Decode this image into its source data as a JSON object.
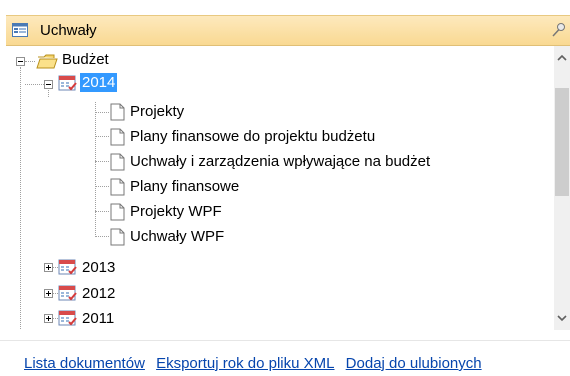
{
  "header": {
    "title": "Uchwały",
    "icon": "window-list-icon",
    "pin_icon": "pin-icon"
  },
  "tree": {
    "root": {
      "label": "Budżet",
      "icon": "folder-icon",
      "expanded": true
    },
    "year_2014": {
      "label": "2014",
      "icon": "calendar-icon",
      "expanded": true,
      "selected": true,
      "children": [
        {
          "label": "Projekty"
        },
        {
          "label": "Plany finansowe do projektu budżetu"
        },
        {
          "label": "Uchwały i zarządzenia wpływające na budżet"
        },
        {
          "label": "Plany finansowe"
        },
        {
          "label": "Projekty WPF"
        },
        {
          "label": "Uchwały WPF"
        }
      ]
    },
    "collapsed_years": [
      {
        "label": "2013"
      },
      {
        "label": "2012"
      },
      {
        "label": "2011"
      }
    ]
  },
  "footer": {
    "links": [
      {
        "label": "Lista dokumentów"
      },
      {
        "label": "Eksportuj rok do pliku XML"
      },
      {
        "label": "Dodaj do ulubionych"
      }
    ]
  },
  "colors": {
    "header_bg": "#fbe0a5",
    "selection": "#3399ff",
    "link": "#0645ad"
  }
}
